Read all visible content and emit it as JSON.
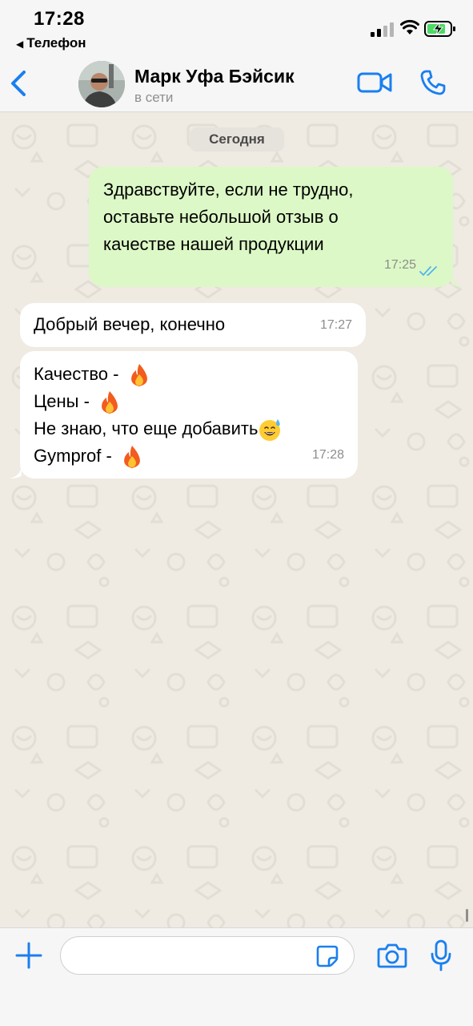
{
  "status_bar": {
    "time": "17:28",
    "back_app": "Телефон",
    "back_arrow": "◀"
  },
  "header": {
    "contact_name": "Марк Уфа Бэйсик",
    "contact_status": "в сети",
    "icons": [
      "chevron-left-icon",
      "video-call-icon",
      "phone-call-icon"
    ],
    "accent_color": "#1a7ff0"
  },
  "chat": {
    "date_label": "Сегодня",
    "messages": [
      {
        "direction": "outgoing",
        "lines": [
          "Здравствуйте, если не трудно,",
          "оставьте небольшой отзыв о",
          "качестве нашей продукции"
        ],
        "time": "17:25",
        "read": true
      },
      {
        "direction": "incoming",
        "lines": [
          "Добрый вечер, конечно"
        ],
        "time": "17:27"
      },
      {
        "direction": "incoming",
        "lines": [
          "Качество -",
          "Цены -",
          "Не знаю, что еще добавить",
          "Gymprof -"
        ],
        "line_emojis": [
          "fire-emoji",
          "fire-emoji",
          "sweat-smile-emoji",
          "fire-emoji"
        ],
        "time": "17:28"
      }
    ],
    "colors": {
      "outgoing_bubble": "#dcf8c6",
      "incoming_bubble": "#ffffff",
      "read_ticks": "#4fb6ec"
    }
  },
  "input_bar": {
    "placeholder": "",
    "icons": [
      "plus-icon",
      "sticker-icon",
      "camera-icon",
      "microphone-icon"
    ]
  }
}
